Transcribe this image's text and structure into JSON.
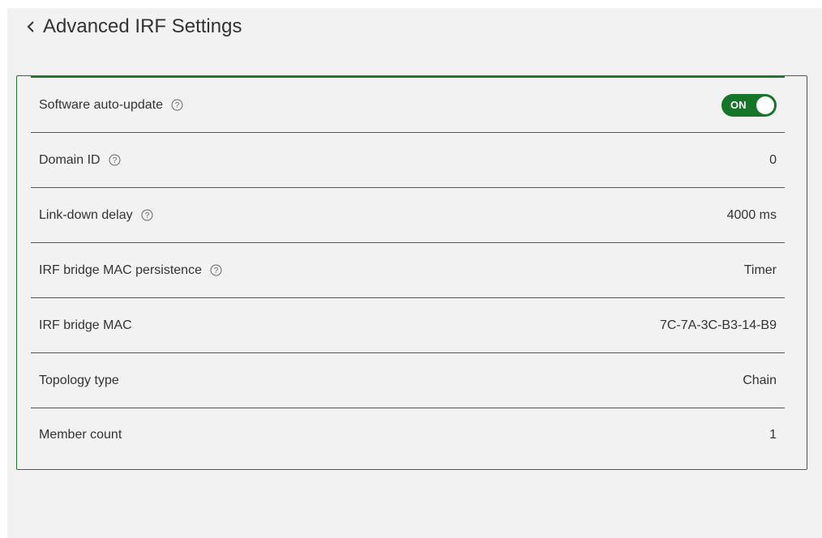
{
  "header": {
    "back_icon": "chevron-left-icon",
    "title": "Advanced IRF Settings"
  },
  "settings": [
    {
      "label": "Software auto-update",
      "help": true,
      "type": "toggle",
      "value": "ON",
      "on": true
    },
    {
      "label": "Domain ID",
      "help": true,
      "type": "text",
      "value": "0"
    },
    {
      "label": "Link-down delay",
      "help": true,
      "type": "text",
      "value": "4000 ms"
    },
    {
      "label": "IRF bridge MAC persistence",
      "help": true,
      "type": "text",
      "value": "Timer"
    },
    {
      "label": "IRF bridge MAC",
      "help": false,
      "type": "text",
      "value": "7C-7A-3C-B3-14-B9"
    },
    {
      "label": "Topology type",
      "help": false,
      "type": "text",
      "value": "Chain"
    },
    {
      "label": "Member count",
      "help": false,
      "type": "text",
      "value": "1"
    }
  ],
  "colors": {
    "accent": "#1b7a2b",
    "toggle_on": "#17752a",
    "background": "#f2f2f2",
    "text": "#333333"
  }
}
